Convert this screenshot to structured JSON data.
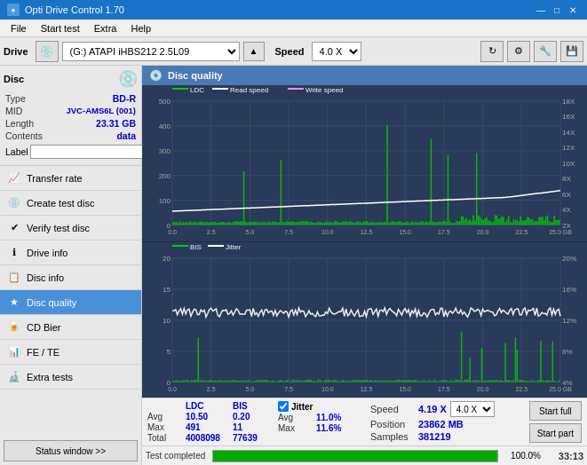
{
  "titlebar": {
    "title": "Opti Drive Control 1.70",
    "minimize": "—",
    "maximize": "□",
    "close": "✕"
  },
  "menubar": {
    "items": [
      "File",
      "Start test",
      "Extra",
      "Help"
    ]
  },
  "toolbar": {
    "drive_label": "Drive",
    "drive_value": "(G:) ATAPI iHBS212  2.5L09",
    "speed_label": "Speed",
    "speed_value": "4.0 X"
  },
  "disc": {
    "title": "Disc",
    "type_label": "Type",
    "type_value": "BD-R",
    "mid_label": "MID",
    "mid_value": "JVC-AMS6L (001)",
    "length_label": "Length",
    "length_value": "23.31 GB",
    "contents_label": "Contents",
    "contents_value": "data",
    "label_label": "Label"
  },
  "sidebar_nav": [
    {
      "id": "transfer-rate",
      "label": "Transfer rate",
      "icon": "📈"
    },
    {
      "id": "create-test-disc",
      "label": "Create test disc",
      "icon": "💿"
    },
    {
      "id": "verify-test-disc",
      "label": "Verify test disc",
      "icon": "✔"
    },
    {
      "id": "drive-info",
      "label": "Drive info",
      "icon": "ℹ"
    },
    {
      "id": "disc-info",
      "label": "Disc info",
      "icon": "📋"
    },
    {
      "id": "disc-quality",
      "label": "Disc quality",
      "icon": "★",
      "active": true
    },
    {
      "id": "cd-bier",
      "label": "CD Bier",
      "icon": "🍺"
    },
    {
      "id": "fe-te",
      "label": "FE / TE",
      "icon": "📊"
    },
    {
      "id": "extra-tests",
      "label": "Extra tests",
      "icon": "🔬"
    }
  ],
  "status_btn": "Status window >>",
  "panel": {
    "title": "Disc quality"
  },
  "chart1": {
    "legend": [
      {
        "label": "LDC",
        "color": "#00cc00"
      },
      {
        "label": "Read speed",
        "color": "#ffffff"
      },
      {
        "label": "Write speed",
        "color": "#ff88ff"
      }
    ],
    "y_labels_left": [
      "500",
      "400",
      "300",
      "200",
      "100",
      "0"
    ],
    "y_labels_right": [
      "18X",
      "16X",
      "14X",
      "12X",
      "10X",
      "8X",
      "6X",
      "4X",
      "2X"
    ],
    "x_labels": [
      "0.0",
      "2.5",
      "5.0",
      "7.5",
      "10.0",
      "12.5",
      "15.0",
      "17.5",
      "20.0",
      "22.5",
      "25.0 GB"
    ]
  },
  "chart2": {
    "legend": [
      {
        "label": "BIS",
        "color": "#00cc00"
      },
      {
        "label": "Jitter",
        "color": "#ffffff"
      }
    ],
    "y_labels_left": [
      "20",
      "15",
      "10",
      "5",
      "0"
    ],
    "y_labels_right": [
      "20%",
      "16%",
      "12%",
      "8%",
      "4%"
    ],
    "x_labels": [
      "0.0",
      "2.5",
      "5.0",
      "7.5",
      "10.0",
      "12.5",
      "15.0",
      "17.5",
      "20.0",
      "22.5",
      "25.0 GB"
    ]
  },
  "stats": {
    "ldc_label": "LDC",
    "bis_label": "BIS",
    "jitter_label": "Jitter",
    "speed_label": "Speed",
    "avg_label": "Avg",
    "max_label": "Max",
    "total_label": "Total",
    "ldc_avg": "10.50",
    "ldc_max": "491",
    "ldc_total": "4008098",
    "bis_avg": "0.20",
    "bis_max": "11",
    "bis_total": "77639",
    "jitter_avg": "11.0%",
    "jitter_max": "11.6%",
    "speed_val": "4.19 X",
    "speed_select": "4.0 X",
    "position_label": "Position",
    "position_val": "23862 MB",
    "samples_label": "Samples",
    "samples_val": "381219"
  },
  "buttons": {
    "start_full": "Start full",
    "start_part": "Start part"
  },
  "bottom": {
    "status": "Test completed",
    "progress": 100,
    "time": "33:13"
  },
  "colors": {
    "ldc_bar": "#00dd00",
    "bis_bar": "#00dd00",
    "read_speed": "#ffffff",
    "write_speed": "#ff88ff",
    "jitter_line": "#ffffff",
    "grid": "#3a4a6a",
    "bg_chart": "#2a3a5a"
  }
}
